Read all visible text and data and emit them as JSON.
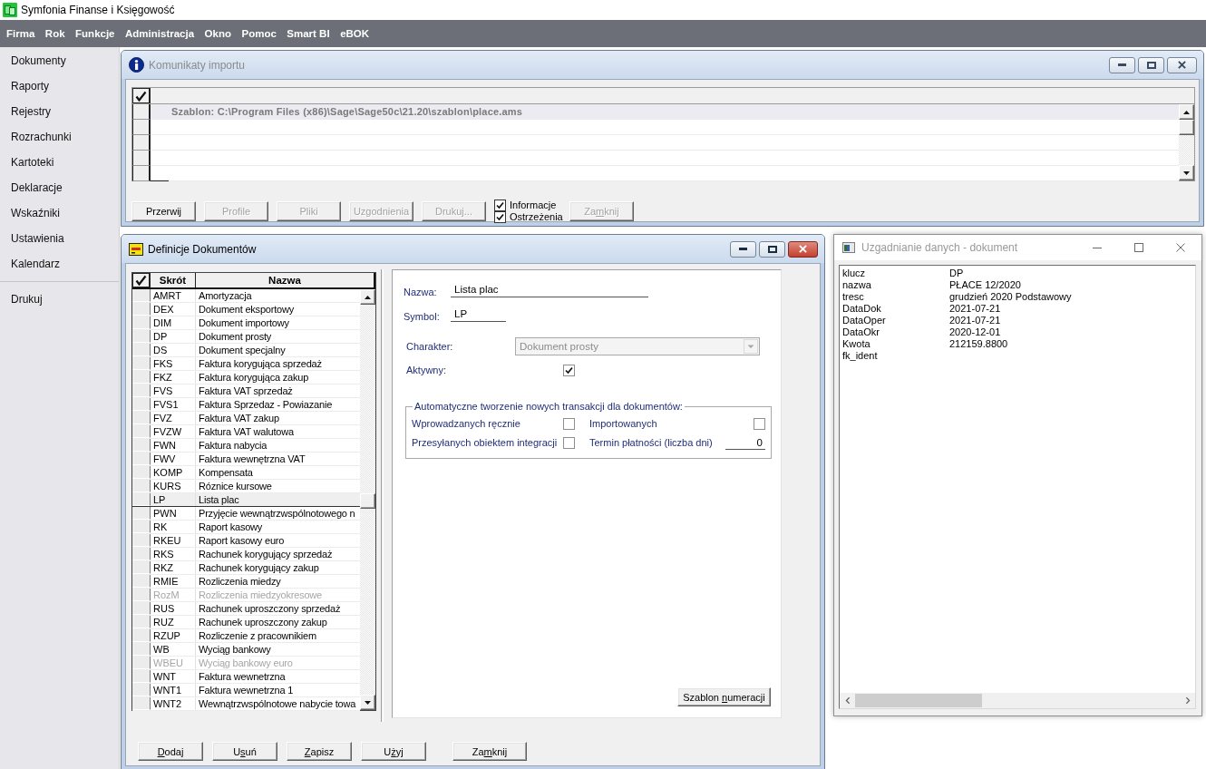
{
  "app_title": "Symfonia Finanse i Księgowość",
  "menu": [
    "Firma",
    "Rok",
    "Funkcje",
    "Administracja",
    "Okno",
    "Pomoc",
    "Smart BI",
    "eBOK"
  ],
  "sidebar": {
    "sections": [
      {
        "items": [
          "Dokumenty",
          "Raporty",
          "Rejestry",
          "Rozrachunki",
          "Kartoteki",
          "Deklaracje",
          "Wskaźniki",
          "Ustawienia",
          "Kalendarz"
        ]
      },
      {
        "items": [
          "Drukuj"
        ]
      }
    ]
  },
  "import_window": {
    "title": "Komunikaty importu",
    "active": false,
    "messages": [
      {
        "text": "Szablon: C:\\Program Files (x86)\\Sage\\Sage50c\\21.20\\szablon\\place.ams",
        "selected": true
      }
    ],
    "controls": [
      {
        "kind": "button",
        "label": "Przerwij",
        "disabled": false
      },
      {
        "kind": "button",
        "label": "Profile",
        "disabled": true
      },
      {
        "kind": "button",
        "label": "Pliki",
        "disabled": true
      },
      {
        "kind": "button",
        "label": "Uzgodnienia",
        "disabled": true
      },
      {
        "kind": "button",
        "label": "Drukuj...",
        "disabled": true
      },
      {
        "kind": "checkboxes",
        "options": [
          {
            "label": "Informacje",
            "checked": true
          },
          {
            "label": "Ostrzeżenia",
            "checked": true
          }
        ]
      },
      {
        "kind": "button",
        "label_start": "Za",
        "access_key": "m",
        "label_end": "knij",
        "disabled": true
      }
    ]
  },
  "definitions_window": {
    "title": "Definicje Dokumentów",
    "active": true,
    "table": {
      "columns": [
        "Skrót",
        "Nazwa"
      ],
      "rows": [
        {
          "code": "AMRT",
          "name": "Amortyzacja",
          "selected": false,
          "disabled": false
        },
        {
          "code": "DEX",
          "name": "Dokument eksportowy",
          "selected": false,
          "disabled": false
        },
        {
          "code": "DIM",
          "name": "Dokument importowy",
          "selected": false,
          "disabled": false
        },
        {
          "code": "DP",
          "name": "Dokument prosty",
          "selected": false,
          "disabled": false
        },
        {
          "code": "DS",
          "name": "Dokument specjalny",
          "selected": false,
          "disabled": false
        },
        {
          "code": "FKS",
          "name": "Faktura korygująca sprzedaż",
          "selected": false,
          "disabled": false
        },
        {
          "code": "FKZ",
          "name": "Faktura korygująca zakup",
          "selected": false,
          "disabled": false
        },
        {
          "code": "FVS",
          "name": "Faktura VAT sprzedaż",
          "selected": false,
          "disabled": false
        },
        {
          "code": "FVS1",
          "name": "Faktura Sprzedaz - Powiazanie",
          "selected": false,
          "disabled": false
        },
        {
          "code": "FVZ",
          "name": "Faktura VAT zakup",
          "selected": false,
          "disabled": false
        },
        {
          "code": "FVZW",
          "name": "Faktura VAT walutowa",
          "selected": false,
          "disabled": false
        },
        {
          "code": "FWN",
          "name": "Faktura nabycia",
          "selected": false,
          "disabled": false
        },
        {
          "code": "FWV",
          "name": "Faktura wewnętrzna VAT",
          "selected": false,
          "disabled": false
        },
        {
          "code": "KOMP",
          "name": "Kompensata",
          "selected": false,
          "disabled": false
        },
        {
          "code": "KURS",
          "name": "Róznice kursowe",
          "selected": false,
          "disabled": false
        },
        {
          "code": "LP",
          "name": "Lista plac",
          "selected": true,
          "disabled": false
        },
        {
          "code": "PWN",
          "name": "Przyjęcie wewnątrzwspólnotowego n",
          "selected": false,
          "disabled": false
        },
        {
          "code": "RK",
          "name": "Raport kasowy",
          "selected": false,
          "disabled": false
        },
        {
          "code": "RKEU",
          "name": "Raport kasowy euro",
          "selected": false,
          "disabled": false
        },
        {
          "code": "RKS",
          "name": "Rachunek korygujący sprzedaż",
          "selected": false,
          "disabled": false
        },
        {
          "code": "RKZ",
          "name": "Rachunek korygujący zakup",
          "selected": false,
          "disabled": false
        },
        {
          "code": "RMIE",
          "name": "Rozliczenia miedzy",
          "selected": false,
          "disabled": false
        },
        {
          "code": "RozM",
          "name": "Rozliczenia miedzyokresowe",
          "selected": false,
          "disabled": true
        },
        {
          "code": "RUS",
          "name": "Rachunek uproszczony sprzedaż",
          "selected": false,
          "disabled": false
        },
        {
          "code": "RUZ",
          "name": "Rachunek uproszczony zakup",
          "selected": false,
          "disabled": false
        },
        {
          "code": "RZUP",
          "name": "Rozliczenie z pracownikiem",
          "selected": false,
          "disabled": false
        },
        {
          "code": "WB",
          "name": "Wyciąg bankowy",
          "selected": false,
          "disabled": false
        },
        {
          "code": "WBEU",
          "name": "Wyciąg bankowy euro",
          "selected": false,
          "disabled": true
        },
        {
          "code": "WNT",
          "name": "Faktura wewnetrzna",
          "selected": false,
          "disabled": false
        },
        {
          "code": "WNT1",
          "name": "Faktura wewnetrzna 1",
          "selected": false,
          "disabled": false
        },
        {
          "code": "WNT2",
          "name": "Wewnątrzwspólnotowe nabycie towa",
          "selected": false,
          "disabled": false
        }
      ]
    },
    "form": {
      "name": {
        "label": "Nazwa:",
        "value": "Lista plac"
      },
      "symbol": {
        "label": "Symbol:",
        "value": "LP"
      },
      "character": {
        "label": "Charakter:",
        "value": "Dokument prosty",
        "disabled": true
      },
      "active": {
        "label": "Aktywny:",
        "checked": true
      },
      "auto_transactions": {
        "legend": "Automatyczne tworzenie nowych transakcji dla dokumentów:",
        "options": [
          {
            "kind": "checkbox",
            "label": "Wprowadzanych ręcznie",
            "checked": false
          },
          {
            "kind": "checkbox",
            "label": "Importowanych",
            "checked": false
          },
          {
            "kind": "checkbox",
            "label": "Przesyłanych obiektem integracji",
            "checked": false
          },
          {
            "kind": "number",
            "label": "Termin płatności (liczba dni)",
            "value": "0"
          }
        ]
      },
      "numbering_button": {
        "label_start": "Szablon ",
        "access_key": "n",
        "label_end": "umeracji"
      }
    },
    "buttons": [
      {
        "access_key": "D",
        "label_end": "odaj"
      },
      {
        "label_start": "U",
        "access_key": "s",
        "label_end": "uń"
      },
      {
        "access_key": "Z",
        "label_end": "apisz"
      },
      {
        "label_start": "U",
        "access_key": "ż",
        "label_end": "yj"
      },
      {
        "label_start": "Za",
        "access_key": "m",
        "label_end": "knij"
      }
    ]
  },
  "reconciliation_window": {
    "title": "Uzgadnianie danych - dokument",
    "active": false,
    "fields": [
      {
        "key": "klucz",
        "value": "DP"
      },
      {
        "key": "nazwa",
        "value": "PŁACE 12/2020"
      },
      {
        "key": "tresc",
        "value": "grudzień 2020 Podstawowy"
      },
      {
        "key": "DataDok",
        "value": "2021-07-21"
      },
      {
        "key": "DataOper",
        "value": "2021-07-21"
      },
      {
        "key": "DataOkr",
        "value": "2020-12-01"
      },
      {
        "key": "Kwota",
        "value": "212159.8800"
      },
      {
        "key": "fk_ident"
      }
    ]
  }
}
